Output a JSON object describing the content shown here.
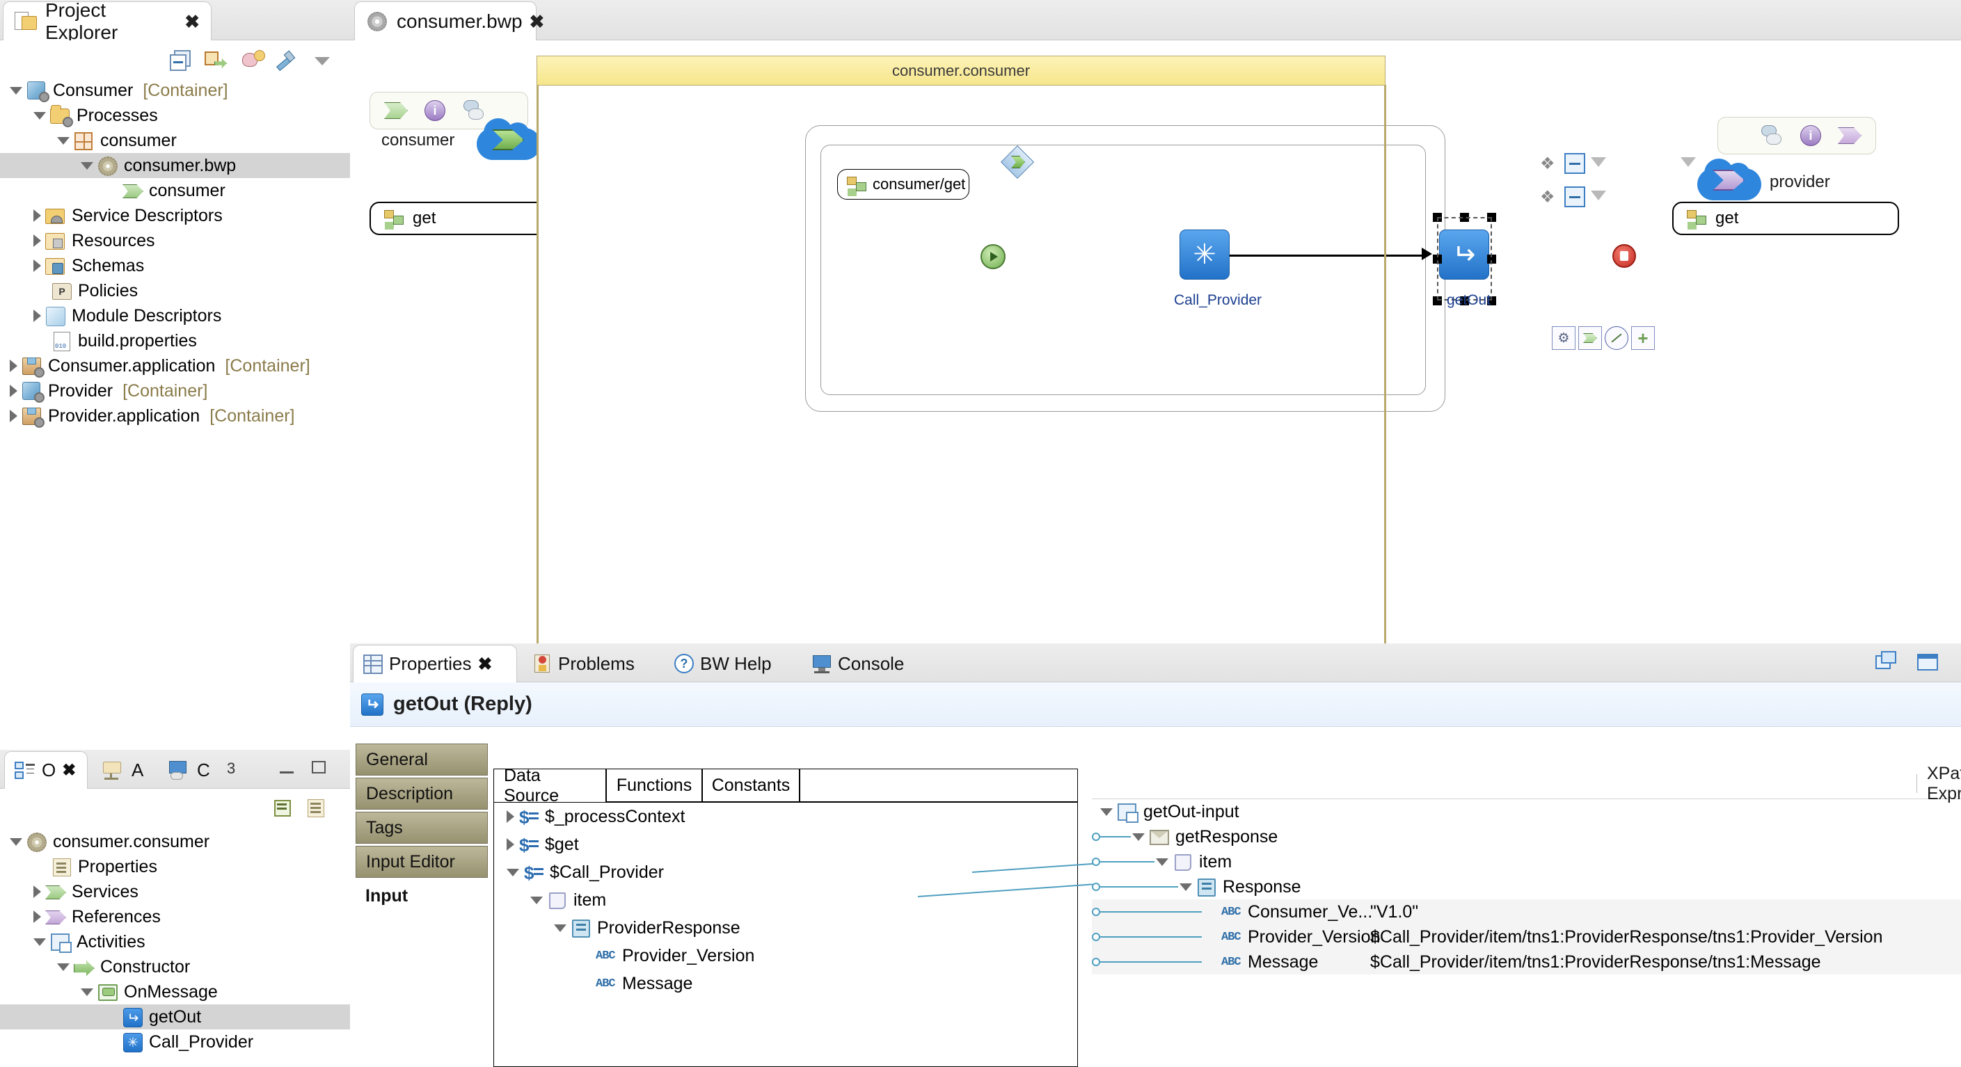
{
  "project_explorer": {
    "tab_label": "Project Explorer",
    "close_glyph": "✖",
    "toolbar_icons": [
      "collapse-all-icon",
      "link-with-editor-icon",
      "filter-icon",
      "brush-icon",
      "view-menu-icon"
    ],
    "tree": [
      {
        "indent": 0,
        "arrow": "down",
        "icon": "container-cube-icon",
        "label": "Consumer",
        "suffix": "[Container]",
        "selected": false
      },
      {
        "indent": 1,
        "arrow": "down",
        "icon": "processes-folder-icon",
        "label": "Processes",
        "suffix": "",
        "selected": false
      },
      {
        "indent": 2,
        "arrow": "down",
        "icon": "package-grid-icon",
        "label": "consumer",
        "suffix": "",
        "selected": false
      },
      {
        "indent": 3,
        "arrow": "down",
        "icon": "process-gear-icon",
        "label": "consumer.bwp",
        "suffix": "",
        "selected": true
      },
      {
        "indent": 4,
        "arrow": "none",
        "icon": "green-service-icon",
        "label": "consumer",
        "suffix": "",
        "selected": false
      },
      {
        "indent": 1,
        "arrow": "right",
        "icon": "service-descriptors-icon",
        "label": "Service Descriptors",
        "suffix": "",
        "selected": false
      },
      {
        "indent": 1,
        "arrow": "right",
        "icon": "resources-folder-icon",
        "label": "Resources",
        "suffix": "",
        "selected": false
      },
      {
        "indent": 1,
        "arrow": "right",
        "icon": "schemas-folder-icon",
        "label": "Schemas",
        "suffix": "",
        "selected": false
      },
      {
        "indent": 1,
        "arrow": "none",
        "icon": "policies-folder-icon",
        "label": "Policies",
        "suffix": "",
        "selected": false
      },
      {
        "indent": 1,
        "arrow": "right",
        "icon": "module-descriptors-icon",
        "label": "Module Descriptors",
        "suffix": "",
        "selected": false
      },
      {
        "indent": 1,
        "arrow": "none",
        "icon": "build-properties-file-icon",
        "label": "build.properties",
        "suffix": "",
        "selected": false
      },
      {
        "indent": 0,
        "arrow": "right",
        "icon": "application-package-icon",
        "label": "Consumer.application",
        "suffix": "[Container]",
        "selected": false
      },
      {
        "indent": 0,
        "arrow": "right",
        "icon": "container-cube-icon",
        "label": "Provider",
        "suffix": "[Container]",
        "selected": false
      },
      {
        "indent": 0,
        "arrow": "right",
        "icon": "application-package-icon",
        "label": "Provider.application",
        "suffix": "[Container]",
        "selected": false
      }
    ]
  },
  "outline_panel": {
    "tabs": [
      {
        "label": "O",
        "icon": "outline-icon",
        "close_glyph": "✖",
        "active": true
      },
      {
        "label": "A",
        "icon": "app-folder-icon",
        "close_glyph": "",
        "active": false
      },
      {
        "label": "C",
        "icon": "cloud-monitor-icon",
        "close_glyph": "",
        "active": false
      }
    ],
    "toolbar_icons": [
      "sort-icon",
      "properties-icon",
      "minimize-icon",
      "maximize-icon"
    ],
    "badge": "3",
    "tree": [
      {
        "indent": 0,
        "arrow": "down",
        "icon": "process-gear-icon",
        "label": "consumer.consumer",
        "selected": false
      },
      {
        "indent": 1,
        "arrow": "none",
        "icon": "properties-icon",
        "label": "Properties",
        "selected": false
      },
      {
        "indent": 1,
        "arrow": "right",
        "icon": "green-service-icon",
        "label": "Services",
        "selected": false
      },
      {
        "indent": 1,
        "arrow": "right",
        "icon": "purple-reference-icon",
        "label": "References",
        "selected": false
      },
      {
        "indent": 1,
        "arrow": "down",
        "icon": "activities-icon",
        "label": "Activities",
        "selected": false
      },
      {
        "indent": 2,
        "arrow": "down",
        "icon": "constructor-icon",
        "label": "Constructor",
        "selected": false
      },
      {
        "indent": 3,
        "arrow": "down",
        "icon": "onmessage-icon",
        "label": "OnMessage",
        "selected": false
      },
      {
        "indent": 4,
        "arrow": "none",
        "icon": "reply-activity-icon",
        "label": "getOut",
        "selected": true
      },
      {
        "indent": 4,
        "arrow": "none",
        "icon": "call-process-icon",
        "label": "Call_Provider",
        "selected": false
      }
    ]
  },
  "editor": {
    "tab_label": "consumer.bwp",
    "tab_icon": "process-gear-icon",
    "close_glyph": "✖",
    "process_title": "consumer.consumer",
    "left_partner": {
      "name": "consumer",
      "operation": "get",
      "palette_icons": [
        "green-service-icon",
        "info-icon",
        "cloud-stack-icon"
      ]
    },
    "right_partner": {
      "name": "provider",
      "operation": "get",
      "palette_icons": [
        "cloud-stack-icon",
        "info-icon",
        "purple-reference-icon"
      ]
    },
    "receive_label": "consumer/get",
    "activities": [
      {
        "name": "Call_Provider",
        "icon": "call-process-icon",
        "selected": false
      },
      {
        "name": "getOut",
        "icon": "reply-activity-icon",
        "selected": true
      }
    ],
    "floating_buttons": [
      "gear-icon",
      "service-icon",
      "link-icon",
      "add-icon"
    ]
  },
  "properties_panel": {
    "tabs": [
      {
        "label": "Properties",
        "icon": "properties-table-icon",
        "close_glyph": "✖",
        "active": true
      },
      {
        "label": "Problems",
        "icon": "problems-icon",
        "close_glyph": "",
        "active": false
      },
      {
        "label": "BW Help",
        "icon": "help-icon",
        "close_glyph": "",
        "active": false
      },
      {
        "label": "Console",
        "icon": "console-icon",
        "close_glyph": "",
        "active": false
      }
    ],
    "toolbar_icons": [
      "restore-icon",
      "maximize-icon"
    ],
    "title": "getOut (Reply)",
    "title_icon": "reply-activity-icon",
    "side_tabs": [
      {
        "label": "General",
        "current": false
      },
      {
        "label": "Description",
        "current": false
      },
      {
        "label": "Tags",
        "current": false
      },
      {
        "label": "Input Editor",
        "current": false
      },
      {
        "label": "Input",
        "current": true
      }
    ],
    "mapper": {
      "source_tabs": [
        {
          "label": "Data Source",
          "active": true
        },
        {
          "label": "Functions",
          "active": false
        },
        {
          "label": "Constants",
          "active": false
        }
      ],
      "source_tree": [
        {
          "indent": 0,
          "arrow": "right",
          "icon": "variable-icon",
          "label": "$_processContext"
        },
        {
          "indent": 0,
          "arrow": "right",
          "icon": "variable-icon",
          "label": "$get"
        },
        {
          "indent": 0,
          "arrow": "down",
          "icon": "variable-icon",
          "label": "$Call_Provider"
        },
        {
          "indent": 1,
          "arrow": "down",
          "icon": "item-icon",
          "label": "item"
        },
        {
          "indent": 2,
          "arrow": "down",
          "icon": "record-icon",
          "label": "ProviderResponse"
        },
        {
          "indent": 3,
          "arrow": "none",
          "icon": "abc-string-icon",
          "label": "Provider_Version"
        },
        {
          "indent": 3,
          "arrow": "none",
          "icon": "abc-string-icon",
          "label": "Message"
        }
      ],
      "xpath_column_header": "XPath Expression",
      "target_rows": [
        {
          "indent": 0,
          "arrow": "down",
          "icon": "input-root-icon",
          "label": "getOut-input",
          "expr": "",
          "link": false,
          "shaded": false
        },
        {
          "indent": 1,
          "arrow": "down",
          "icon": "envelope-icon",
          "label": "getResponse",
          "expr": "",
          "link": true,
          "shaded": false
        },
        {
          "indent": 2,
          "arrow": "down",
          "icon": "item-icon",
          "label": "item",
          "expr": "",
          "link": true,
          "shaded": false
        },
        {
          "indent": 3,
          "arrow": "down",
          "icon": "record-icon",
          "label": "Response",
          "expr": "",
          "link": true,
          "shaded": false
        },
        {
          "indent": 4,
          "arrow": "none",
          "icon": "abc-string-icon",
          "label": "Consumer_Ve...",
          "expr": "\"V1.0\"",
          "link": true,
          "shaded": true
        },
        {
          "indent": 4,
          "arrow": "none",
          "icon": "abc-string-icon",
          "label": "Provider_Version",
          "expr": "$Call_Provider/item/tns1:ProviderResponse/tns1:Provider_Version",
          "link": true,
          "shaded": true
        },
        {
          "indent": 4,
          "arrow": "none",
          "icon": "abc-string-icon",
          "label": "Message",
          "expr": "$Call_Provider/item/tns1:ProviderResponse/tns1:Message",
          "link": true,
          "shaded": true
        }
      ]
    }
  },
  "colors": {
    "accent_blue": "#2272c8",
    "process_header": "#f6e68b",
    "selection_gray": "#d4d4d4",
    "link_teal": "#4f9fc0",
    "container_tag": "#8a7b4a"
  }
}
